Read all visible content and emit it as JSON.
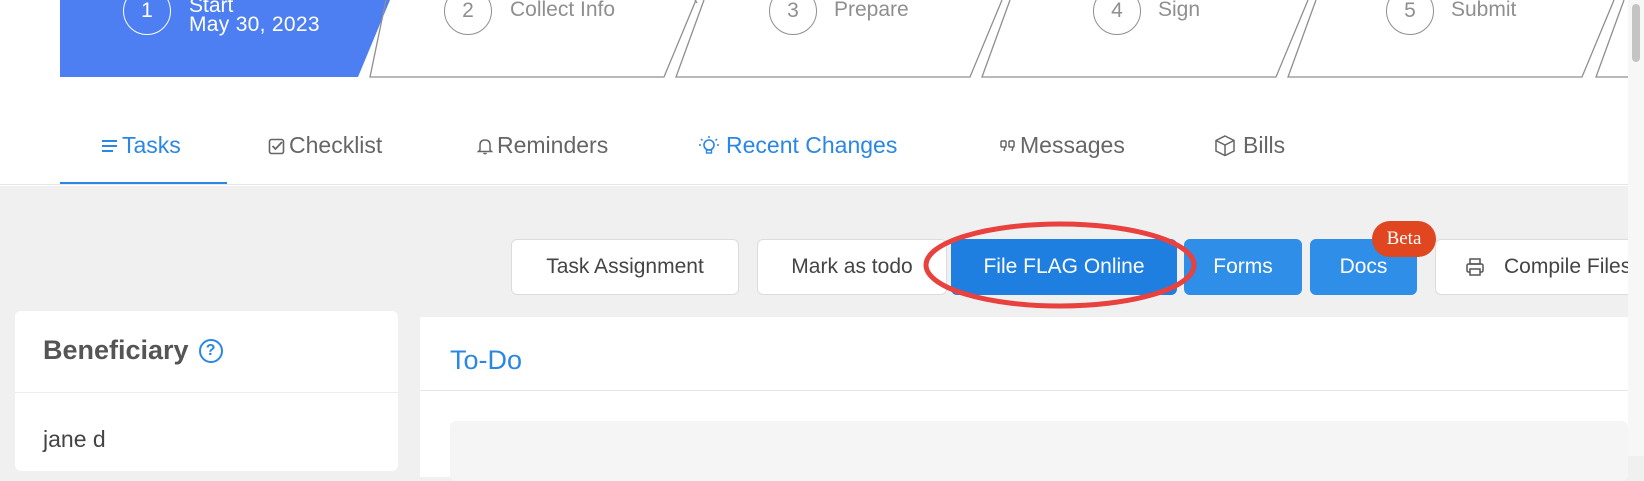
{
  "steps": [
    {
      "number": "1",
      "label": "Start",
      "date": "May 30, 2023",
      "active": true
    },
    {
      "number": "2",
      "label": "Collect Info"
    },
    {
      "number": "3",
      "label": "Prepare"
    },
    {
      "number": "4",
      "label": "Sign"
    },
    {
      "number": "5",
      "label": "Submit"
    }
  ],
  "tabs": [
    {
      "label": "Tasks",
      "icon": "list-icon",
      "active": true
    },
    {
      "label": "Checklist",
      "icon": "checkbox-icon"
    },
    {
      "label": "Reminders",
      "icon": "bell-icon"
    },
    {
      "label": "Recent Changes",
      "icon": "lightbulb-icon"
    },
    {
      "label": "Messages",
      "icon": "quote-icon"
    },
    {
      "label": "Bills",
      "icon": "box-icon"
    }
  ],
  "toolbar": {
    "task_assignment": "Task Assignment",
    "mark_todo": "Mark as todo",
    "file_flag": "File FLAG Online",
    "forms": "Forms",
    "docs": "Docs",
    "beta": "Beta",
    "compile_files": "Compile Files"
  },
  "beneficiary": {
    "title": "Beneficiary",
    "help": "?",
    "name": "jane d"
  },
  "todo": {
    "title": "To-Do"
  },
  "colors": {
    "accent": "#2a87e3",
    "primary_button": "#2e8ee8",
    "step_active": "#4d7ff2",
    "beta_badge": "#e0461f",
    "annotation": "#e8413e"
  }
}
